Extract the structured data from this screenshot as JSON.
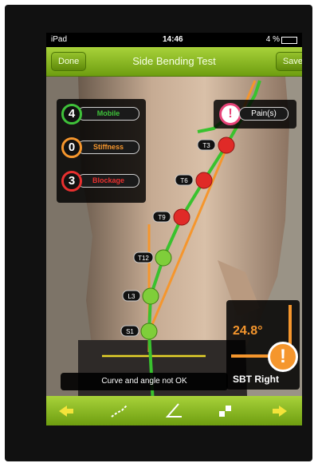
{
  "status_bar": {
    "device": "iPad",
    "time": "14:46",
    "battery": "4 %"
  },
  "nav": {
    "done_label": "Done",
    "title": "Side Bending Test",
    "save_label": "Save"
  },
  "legend": [
    {
      "count": "4",
      "label": "Mobile",
      "color": "#3fc23a"
    },
    {
      "count": "0",
      "label": "Stiffness",
      "color": "#f5962d"
    },
    {
      "count": "3",
      "label": "Blockage",
      "color": "#e8302f"
    }
  ],
  "pain": {
    "icon_text": "!",
    "label": "Pain(s)",
    "color": "#e74378"
  },
  "vertebrae": [
    {
      "label": "T3",
      "status": "blockage"
    },
    {
      "label": "T6",
      "status": "blockage"
    },
    {
      "label": "T9",
      "status": "blockage"
    },
    {
      "label": "T12",
      "status": "mobile"
    },
    {
      "label": "L3",
      "status": "mobile"
    },
    {
      "label": "S1",
      "status": "mobile"
    }
  ],
  "angle": {
    "value": "24.8°",
    "label": "SBT Right",
    "warn_text": "!"
  },
  "message": "Curve and angle not OK",
  "toolbar": {
    "icons": [
      "arrow-left-icon",
      "spine-curve-icon",
      "angle-icon",
      "checker-icon",
      "arrow-right-icon"
    ]
  }
}
